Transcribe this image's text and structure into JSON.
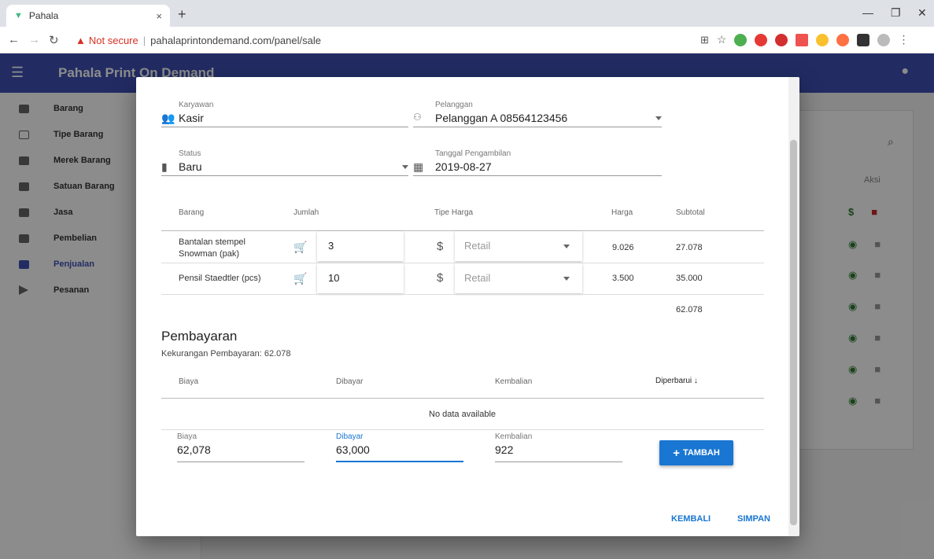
{
  "browser": {
    "tab_title": "Pahala",
    "tab_close": "×",
    "new_tab": "+",
    "not_secure": "Not secure",
    "url": "pahalaprintondemand.com/panel/sale"
  },
  "app": {
    "title": "Pahala Print On Demand",
    "accent_color": "#3f51b5"
  },
  "sidebar": {
    "items": [
      {
        "label": "Barang",
        "icon": "box-icon"
      },
      {
        "label": "Tipe Barang",
        "icon": "label-icon"
      },
      {
        "label": "Merek Barang",
        "icon": "card-icon"
      },
      {
        "label": "Satuan Barang",
        "icon": "tag-icon"
      },
      {
        "label": "Jasa",
        "icon": "folder-icon"
      },
      {
        "label": "Pembelian",
        "icon": "inbox-icon"
      },
      {
        "label": "Penjualan",
        "icon": "sale-icon"
      },
      {
        "label": "Pesanan",
        "icon": "send-icon"
      }
    ],
    "active": "Penjualan"
  },
  "background": {
    "aksi_header": "Aksi"
  },
  "form": {
    "karyawan": {
      "label": "Karyawan",
      "value": "Kasir"
    },
    "pelanggan": {
      "label": "Pelanggan",
      "value": "Pelanggan A 08564123456"
    },
    "status": {
      "label": "Status",
      "value": "Baru"
    },
    "tanggal": {
      "label": "Tanggal Pengambilan",
      "value": "2019-08-27"
    }
  },
  "items_table": {
    "headers": {
      "barang": "Barang",
      "jumlah": "Jumlah",
      "tipe_harga": "Tipe Harga",
      "harga": "Harga",
      "subtotal": "Subtotal"
    },
    "rows": [
      {
        "barang_line1": "Bantalan stempel",
        "barang_line2": "Snowman (pak)",
        "jumlah": "3",
        "tipe_harga": "Retail",
        "harga": "9.026",
        "subtotal": "27.078"
      },
      {
        "barang_line1": "Pensil Staedtler (pcs)",
        "barang_line2": "",
        "jumlah": "10",
        "tipe_harga": "Retail",
        "harga": "3.500",
        "subtotal": "35.000"
      }
    ],
    "total": "62.078"
  },
  "payment": {
    "title": "Pembayaran",
    "kekurangan": "Kekurangan Pembayaran: 62.078",
    "headers": {
      "biaya": "Biaya",
      "dibayar": "Dibayar",
      "kembalian": "Kembalian",
      "diperbarui": "Diperbarui"
    },
    "no_data": "No data available",
    "inputs": {
      "biaya": {
        "label": "Biaya",
        "value": "62,078"
      },
      "dibayar": {
        "label": "Dibayar",
        "value": "63,000"
      },
      "kembalian": {
        "label": "Kembalian",
        "value": "922"
      }
    },
    "tambah_label": "TAMBAH"
  },
  "actions": {
    "kembali": "KEMBALI",
    "simpan": "SIMPAN"
  }
}
